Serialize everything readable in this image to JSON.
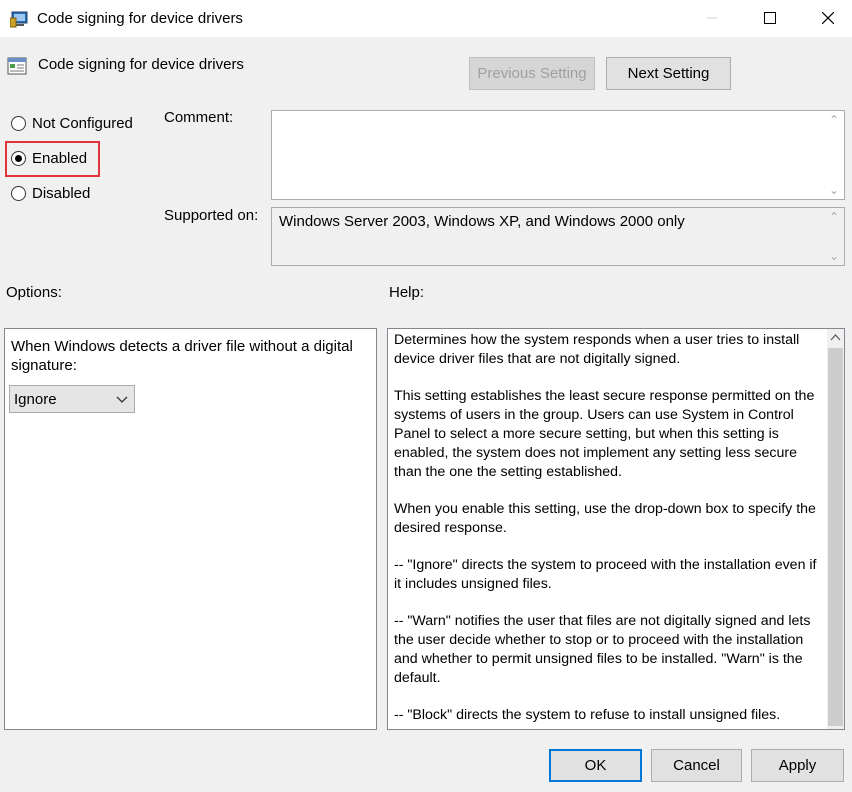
{
  "window": {
    "title": "Code signing for device drivers",
    "icons": {
      "app": "policy-app-icon",
      "minimize": "minimize-icon",
      "maximize": "maximize-icon",
      "close": "close-icon"
    }
  },
  "header": {
    "policy_title": "Code signing for device drivers",
    "policy_icon": "policy-setting-icon",
    "previous_label": "Previous Setting",
    "next_label": "Next Setting"
  },
  "state": {
    "not_configured_label": "Not Configured",
    "enabled_label": "Enabled",
    "disabled_label": "Disabled",
    "selected": "Enabled",
    "highlight_color": "#e0363b"
  },
  "comment": {
    "label": "Comment:",
    "value": ""
  },
  "supported": {
    "label": "Supported on:",
    "value": "Windows Server 2003, Windows XP, and Windows 2000 only"
  },
  "options": {
    "label": "Options:",
    "prompt": "When Windows detects a driver file without a digital signature:",
    "selected_value": "Ignore"
  },
  "help": {
    "label": "Help:",
    "paragraphs": [
      "Determines how the system responds when a user tries to install device driver files that are not digitally signed.",
      "This setting establishes the least secure response permitted on the systems of users in the group. Users can use System in Control Panel to select a more secure setting, but when this setting is enabled, the system does not implement any setting less secure than the one the setting established.",
      "When you enable this setting, use the drop-down box to specify the desired response.",
      "--   \"Ignore\" directs the system to proceed with the installation even if it includes unsigned files.",
      "--   \"Warn\" notifies the user that files are not digitally signed and lets the user decide whether to stop or to proceed with the installation and whether to permit unsigned files to be installed. \"Warn\" is the default.",
      "--   \"Block\" directs the system to refuse to install unsigned files."
    ]
  },
  "footer": {
    "ok_label": "OK",
    "cancel_label": "Cancel",
    "apply_label": "Apply",
    "accent": "#0078d7"
  }
}
